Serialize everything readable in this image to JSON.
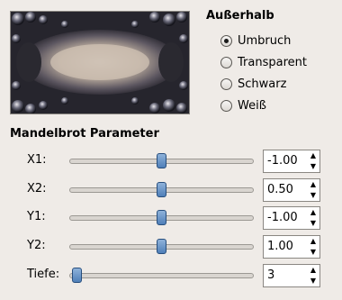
{
  "outside": {
    "title": "Außerhalb",
    "options": [
      {
        "label": "Umbruch",
        "checked": true
      },
      {
        "label": "Transparent",
        "checked": false
      },
      {
        "label": "Schwarz",
        "checked": false
      },
      {
        "label": "Weiß",
        "checked": false
      }
    ]
  },
  "params": {
    "title": "Mandelbrot Parameter",
    "rows": [
      {
        "label": "X1:",
        "value": "-1.00",
        "slider_fraction": 0.5
      },
      {
        "label": "X2:",
        "value": "0.50",
        "slider_fraction": 0.5
      },
      {
        "label": "Y1:",
        "value": "-1.00",
        "slider_fraction": 0.5
      },
      {
        "label": "Y2:",
        "value": "1.00",
        "slider_fraction": 0.5
      },
      {
        "label": "Tiefe:",
        "value": "3",
        "slider_fraction": 0.0
      }
    ]
  },
  "icons": {
    "spin_up": "▲",
    "spin_down": "▼"
  }
}
